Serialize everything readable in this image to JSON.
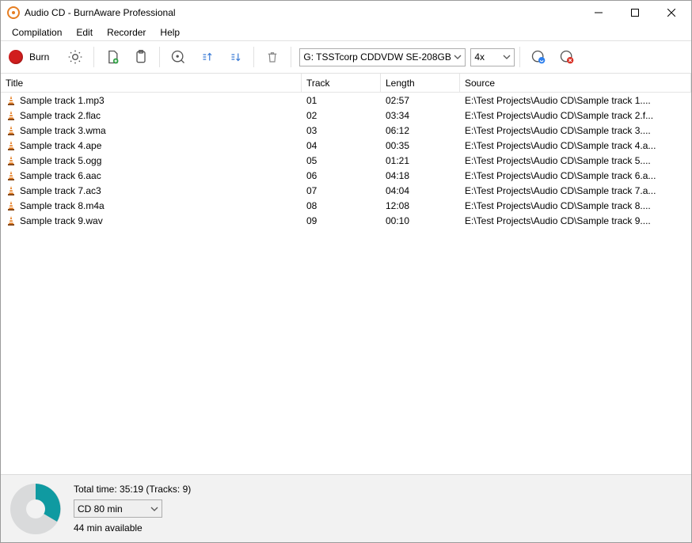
{
  "title": "Audio CD - BurnAware Professional",
  "menu": [
    "Compilation",
    "Edit",
    "Recorder",
    "Help"
  ],
  "toolbar": {
    "burn_label": "Burn",
    "drive_selected": "G: TSSTcorp CDDVDW SE-208GB",
    "speed_selected": "4x"
  },
  "columns": {
    "title": "Title",
    "track": "Track",
    "length": "Length",
    "source": "Source"
  },
  "tracks": [
    {
      "title": "Sample track 1.mp3",
      "track": "01",
      "length": "02:57",
      "source": "E:\\Test Projects\\Audio CD\\Sample track 1...."
    },
    {
      "title": "Sample track 2.flac",
      "track": "02",
      "length": "03:34",
      "source": "E:\\Test Projects\\Audio CD\\Sample track 2.f..."
    },
    {
      "title": "Sample track 3.wma",
      "track": "03",
      "length": "06:12",
      "source": "E:\\Test Projects\\Audio CD\\Sample track 3...."
    },
    {
      "title": "Sample track 4.ape",
      "track": "04",
      "length": "00:35",
      "source": "E:\\Test Projects\\Audio CD\\Sample track 4.a..."
    },
    {
      "title": "Sample track 5.ogg",
      "track": "05",
      "length": "01:21",
      "source": "E:\\Test Projects\\Audio CD\\Sample track 5...."
    },
    {
      "title": "Sample track 6.aac",
      "track": "06",
      "length": "04:18",
      "source": "E:\\Test Projects\\Audio CD\\Sample track 6.a..."
    },
    {
      "title": "Sample track 7.ac3",
      "track": "07",
      "length": "04:04",
      "source": "E:\\Test Projects\\Audio CD\\Sample track 7.a..."
    },
    {
      "title": "Sample track 8.m4a",
      "track": "08",
      "length": "12:08",
      "source": "E:\\Test Projects\\Audio CD\\Sample track 8...."
    },
    {
      "title": "Sample track 9.wav",
      "track": "09",
      "length": "00:10",
      "source": "E:\\Test Projects\\Audio CD\\Sample track 9...."
    }
  ],
  "footer": {
    "total_line": "Total time: 35:19 (Tracks: 9)",
    "disc_type": "CD 80 min",
    "available": "44 min available"
  },
  "colors": {
    "accent": "#0f9aa1",
    "burn": "#d11e1e"
  }
}
